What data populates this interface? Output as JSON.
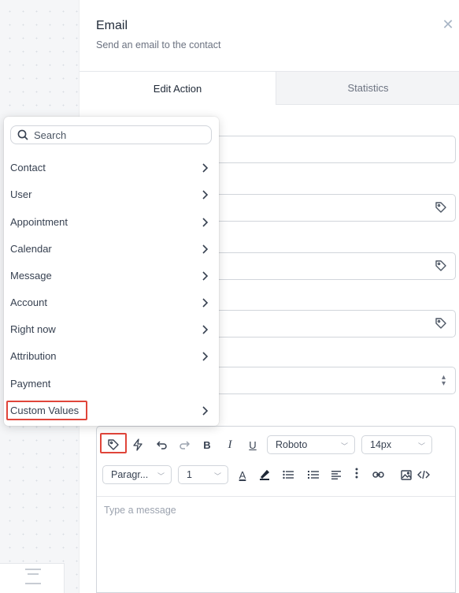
{
  "panel": {
    "title": "Email",
    "subtitle": "Send an email to the contact"
  },
  "tabs": [
    {
      "label": "Edit Action",
      "active": true
    },
    {
      "label": "Statistics",
      "active": false
    }
  ],
  "dropdown": {
    "search_placeholder": "Search",
    "items": [
      {
        "label": "Contact",
        "has_submenu": true
      },
      {
        "label": "User",
        "has_submenu": true
      },
      {
        "label": "Appointment",
        "has_submenu": true
      },
      {
        "label": "Calendar",
        "has_submenu": true
      },
      {
        "label": "Message",
        "has_submenu": true
      },
      {
        "label": "Account",
        "has_submenu": true
      },
      {
        "label": "Right now",
        "has_submenu": true
      },
      {
        "label": "Attribution",
        "has_submenu": true
      },
      {
        "label": "Payment",
        "has_submenu": false
      },
      {
        "label": "Custom Values",
        "has_submenu": true,
        "highlighted": true
      }
    ]
  },
  "editor": {
    "font_family": "Roboto",
    "font_size": "14px",
    "block_format": "Paragr...",
    "line_height": "1",
    "placeholder": "Type a message",
    "bold_label": "B",
    "italic_label": "I",
    "underline_label": "U",
    "text_color_label": "A"
  },
  "colors": {
    "highlight": "#e0453a",
    "close_icon": "#a9b6c6",
    "tab_inactive_bg": "#f3f4f6"
  }
}
